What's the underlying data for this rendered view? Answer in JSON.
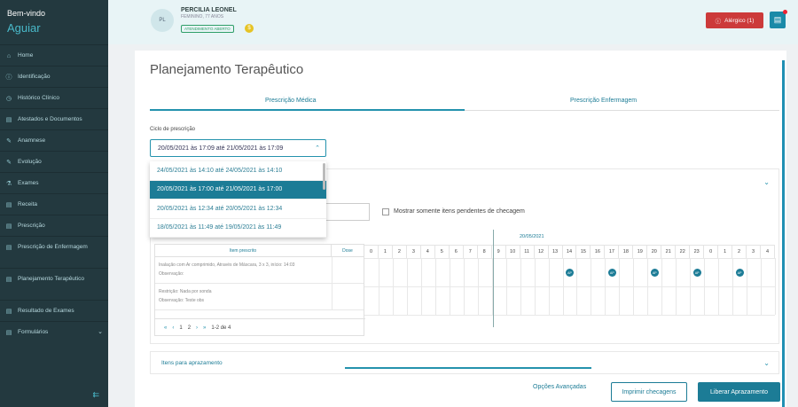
{
  "sidebar": {
    "welcome": "Bem-vindo",
    "user": "Aguiar",
    "items": [
      {
        "label": "Home",
        "icon": "home-icon",
        "glyph": "⌂"
      },
      {
        "label": "Identificação",
        "icon": "info-icon",
        "glyph": "ⓘ"
      },
      {
        "label": "Histórico Clínico",
        "icon": "history-icon",
        "glyph": "◷"
      },
      {
        "label": "Atestados e Documentos",
        "icon": "document-icon",
        "glyph": "▤"
      },
      {
        "label": "Anamnese",
        "icon": "pencil-icon",
        "glyph": "✎"
      },
      {
        "label": "Evolução",
        "icon": "pencil-icon",
        "glyph": "✎"
      },
      {
        "label": "Exames",
        "icon": "exam-icon",
        "glyph": "⚗"
      },
      {
        "label": "Receita",
        "icon": "document-icon",
        "glyph": "▤"
      },
      {
        "label": "Prescrição",
        "icon": "document-icon",
        "glyph": "▤"
      },
      {
        "label": "Prescrição de Enfermagem",
        "icon": "document-icon",
        "glyph": "▤",
        "tall": true
      },
      {
        "label": "Planejamento Terapêutico",
        "icon": "document-icon",
        "glyph": "▤",
        "tall": true
      },
      {
        "label": "Resultado de Exames",
        "icon": "document-icon",
        "glyph": "▤"
      },
      {
        "label": "Formulários",
        "icon": "form-icon",
        "glyph": "▤",
        "chevron": "⌄"
      }
    ],
    "collapse_glyph": "⇇"
  },
  "patient": {
    "initials": "PL",
    "name": "PERCILIA LEONEL",
    "info": "FEMININO, 77 ANOS",
    "status": "ATENDIMENTO ABERTO",
    "dollar": "$"
  },
  "header": {
    "allergy_label": "Alérgico (1)",
    "allergy_glyph": "ⓘ",
    "doc_glyph": "▤"
  },
  "page": {
    "title": "Planejamento Terapêutico",
    "tabs": [
      "Prescrição Médica",
      "Prescrição Enfermagem"
    ],
    "cycle_label": "Ciclo de prescrição",
    "cycle_value": "20/05/2021 às 17:09 até 21/05/2021 às 17:09",
    "cycle_chev": "⌃",
    "dropdown": [
      "24/05/2021 às 14:10 até 24/05/2021 às 14:10",
      "20/05/2021 às 17:00 até 21/05/2021 às 17:00",
      "20/05/2021 às 12:34 até 20/05/2021 às 12:34",
      "18/05/2021 às 11:49 até 19/05/2021 às 11:49"
    ],
    "dropdown_selected": 1,
    "filter_label": "Mostrar somente itens pendentes de checagem",
    "section_chev": "⌄",
    "items_section": "Itens para aprazamento"
  },
  "grid": {
    "date": "20/05/2021",
    "col_item": "Item prescrito",
    "col_dose": "Dose",
    "rows": [
      {
        "line1": "Inalação com Ar comprimido, Através de Máscara, 3 x 3, início: 14:03",
        "line2": "Observação:"
      },
      {
        "line1": "Restrição: Nada por sonda",
        "line2": "Observação: Teste obs"
      }
    ],
    "hours": [
      "0",
      "1",
      "2",
      "3",
      "4",
      "5",
      "6",
      "7",
      "8",
      "9",
      "10",
      "11",
      "12",
      "13",
      "14",
      "15",
      "16",
      "17",
      "18",
      "19",
      "20",
      "21",
      "22",
      "23",
      "0",
      "1",
      "2",
      "3",
      "4"
    ],
    "ap_label": "AP",
    "ap_cols": [
      14,
      17,
      20,
      23,
      26
    ],
    "pager": {
      "first": "«",
      "prev": "‹",
      "pages": [
        "1",
        "2"
      ],
      "next": "›",
      "last": "»",
      "range": "1-2 de 4"
    }
  },
  "footer": {
    "advanced": "Opções Avançadas",
    "print": "Imprimir checagens",
    "release": "Liberar Aprazamento"
  }
}
